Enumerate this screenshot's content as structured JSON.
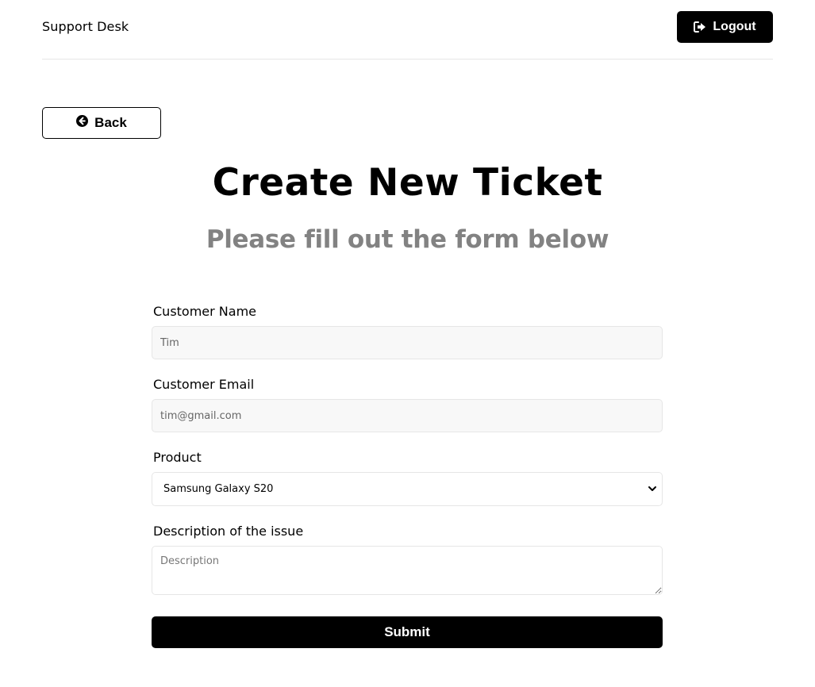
{
  "header": {
    "brand": "Support Desk",
    "logout_label": "Logout"
  },
  "nav": {
    "back_label": "Back"
  },
  "page": {
    "title": "Create New Ticket",
    "subtitle": "Please fill out the form below"
  },
  "form": {
    "name": {
      "label": "Customer Name",
      "value": "Tim"
    },
    "email": {
      "label": "Customer Email",
      "value": "tim@gmail.com"
    },
    "product": {
      "label": "Product",
      "selected": "Samsung Galaxy S20"
    },
    "description": {
      "label": "Description of the issue",
      "placeholder": "Description"
    },
    "submit_label": "Submit"
  },
  "icons": {
    "logout": "sign-out-icon",
    "back": "arrow-circle-left-icon",
    "select": "chevron-down-icon"
  },
  "colors": {
    "primary": "#000000",
    "subtitle": "#828282",
    "input_bg": "#f8f8f8",
    "border": "#e6e6e6"
  }
}
